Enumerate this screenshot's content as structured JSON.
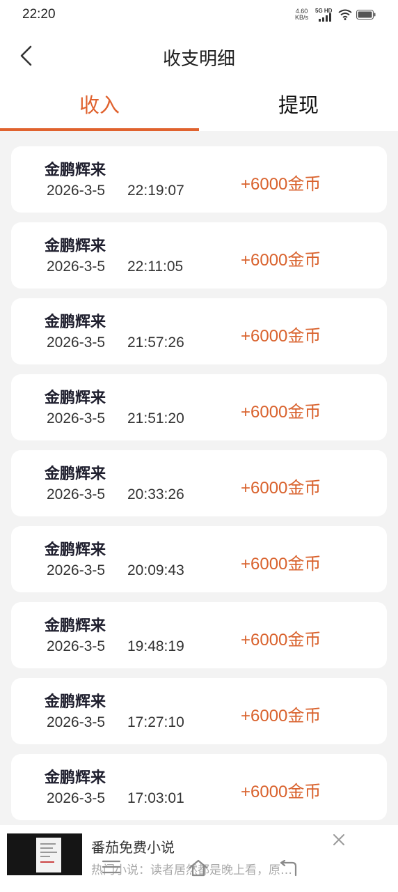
{
  "status_bar": {
    "time": "22:20",
    "net_speed": "4.60",
    "net_speed_unit": "KB/s",
    "network": "5G HD"
  },
  "header": {
    "title": "收支明细"
  },
  "tabs": [
    {
      "label": "收入",
      "active": true
    },
    {
      "label": "提现",
      "active": false
    }
  ],
  "records": [
    {
      "name": "金鹏辉来",
      "date": "2026-3-5",
      "time": "22:19:07",
      "amount": "+6000金币"
    },
    {
      "name": "金鹏辉来",
      "date": "2026-3-5",
      "time": "22:11:05",
      "amount": "+6000金币"
    },
    {
      "name": "金鹏辉来",
      "date": "2026-3-5",
      "time": "21:57:26",
      "amount": "+6000金币"
    },
    {
      "name": "金鹏辉来",
      "date": "2026-3-5",
      "time": "21:51:20",
      "amount": "+6000金币"
    },
    {
      "name": "金鹏辉来",
      "date": "2026-3-5",
      "time": "20:33:26",
      "amount": "+6000金币"
    },
    {
      "name": "金鹏辉来",
      "date": "2026-3-5",
      "time": "20:09:43",
      "amount": "+6000金币"
    },
    {
      "name": "金鹏辉来",
      "date": "2026-3-5",
      "time": "19:48:19",
      "amount": "+6000金币"
    },
    {
      "name": "金鹏辉来",
      "date": "2026-3-5",
      "time": "17:27:10",
      "amount": "+6000金币"
    },
    {
      "name": "金鹏辉来",
      "date": "2026-3-5",
      "time": "17:03:01",
      "amount": "+6000金币"
    }
  ],
  "ad": {
    "title": "番茄免费小说",
    "description": "热门小说：读者居然都是晚上看，原…"
  },
  "icons": {
    "back": "chevron-left-icon",
    "close": "close-icon",
    "nav_menu": "menu-icon",
    "nav_home": "home-icon",
    "nav_back": "back-arrow-icon"
  },
  "colors": {
    "accent": "#e0622e",
    "amount": "#d9622d",
    "background": "#f3f3f3"
  }
}
